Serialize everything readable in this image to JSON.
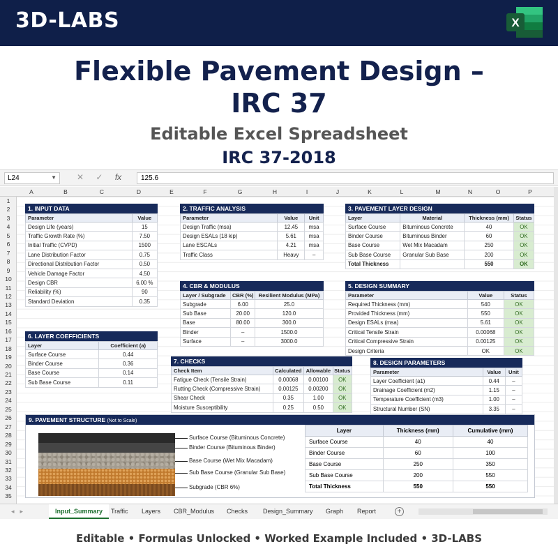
{
  "brand": "3D-LABS",
  "title_line1": "Flexible Pavement Design –",
  "title_line2": "IRC 37",
  "subtitle": "Editable Excel Spreadsheet",
  "subtitle2": "IRC 37-2018",
  "formula_bar": {
    "name_box": "L24",
    "formula_value": "125.6",
    "fx_label": "fx"
  },
  "columns": [
    "A",
    "B",
    "C",
    "D",
    "E",
    "F",
    "G",
    "H",
    "I",
    "J",
    "K",
    "L",
    "M",
    "N",
    "O",
    "P"
  ],
  "rows": [
    "1",
    "2",
    "3",
    "4",
    "5",
    "6",
    "7",
    "8",
    "9",
    "10",
    "11",
    "12",
    "13",
    "14",
    "15",
    "16",
    "17",
    "18",
    "19",
    "20",
    "21",
    "22",
    "23",
    "24",
    "25",
    "26",
    "27",
    "28",
    "29",
    "30",
    "31",
    "32",
    "33",
    "34",
    "35"
  ],
  "input_data": {
    "title": "1. INPUT DATA",
    "headers": [
      "Parameter",
      "Value"
    ],
    "rows": [
      [
        "Design Life (years)",
        "15"
      ],
      [
        "Traffic Growth Rate (%)",
        "7.50"
      ],
      [
        "Initial Traffic (CVPD)",
        "1500"
      ],
      [
        "Lane Distribution Factor",
        "0.75"
      ],
      [
        "Directional Distribution Factor",
        "0.50"
      ],
      [
        "Vehicle Damage Factor",
        "4.50"
      ],
      [
        "Design CBR",
        "6.00 %"
      ],
      [
        "Reliability (%)",
        "90"
      ],
      [
        "Standard Deviation",
        "0.35"
      ]
    ]
  },
  "traffic_analysis": {
    "title": "2. TRAFFIC ANALYSIS",
    "headers": [
      "Parameter",
      "Value",
      "Unit"
    ],
    "rows": [
      [
        "Design Traffic (msa)",
        "12.45",
        "msa"
      ],
      [
        "Design ESALs (18 kip)",
        "5.61",
        "msa"
      ],
      [
        "Lane ESCALs",
        "4.21",
        "msa"
      ],
      [
        "Traffic Class",
        "Heavy",
        "–"
      ]
    ]
  },
  "pavement_layer_design": {
    "title": "3. PAVEMENT LAYER DESIGN",
    "headers": [
      "Layer",
      "Material",
      "Thickness (mm)",
      "Status"
    ],
    "rows": [
      [
        "Surface Course",
        "Bituminous Concrete",
        "40",
        "OK"
      ],
      [
        "Binder Course",
        "Bituminous Binder",
        "60",
        "OK"
      ],
      [
        "Base Course",
        "Wet Mix Macadam",
        "250",
        "OK"
      ],
      [
        "Sub Base Course",
        "Granular Sub Base",
        "200",
        "OK"
      ]
    ],
    "total": [
      "Total Thickness",
      "",
      "550",
      "OK"
    ]
  },
  "cbr_modulus": {
    "title": "4. CBR & MODULUS",
    "headers": [
      "Layer / Subgrade",
      "CBR (%)",
      "Resilient Modulus (MPa)"
    ],
    "rows": [
      [
        "Subgrade",
        "6.00",
        "25.0"
      ],
      [
        "Sub Base",
        "20.00",
        "120.0"
      ],
      [
        "Base",
        "80.00",
        "300.0"
      ],
      [
        "Binder",
        "–",
        "1500.0"
      ],
      [
        "Surface",
        "–",
        "3000.0"
      ]
    ]
  },
  "design_summary": {
    "title": "5. DESIGN SUMMARY",
    "headers": [
      "Parameter",
      "Value",
      "Status"
    ],
    "rows": [
      [
        "Required Thickness (mm)",
        "540",
        "OK"
      ],
      [
        "Provided Thickness (mm)",
        "550",
        "OK"
      ],
      [
        "Design ESALs (msa)",
        "5.61",
        "OK"
      ],
      [
        "Critical Tensile Strain",
        "0.00068",
        "OK"
      ],
      [
        "Critical Compressive Strain",
        "0.00125",
        "OK"
      ],
      [
        "Design Criteria",
        "OK",
        "OK"
      ]
    ]
  },
  "layer_coefficients": {
    "title": "6. LAYER COEFFICIENTS",
    "headers": [
      "Layer",
      "Coefficient (a)"
    ],
    "rows": [
      [
        "Surface Course",
        "0.44"
      ],
      [
        "Binder Course",
        "0.36"
      ],
      [
        "Base Course",
        "0.14"
      ],
      [
        "Sub Base Course",
        "0.11"
      ]
    ]
  },
  "checks": {
    "title": "7. CHECKS",
    "headers": [
      "Check Item",
      "Calculated",
      "Allowable",
      "Status"
    ],
    "rows": [
      [
        "Fatigue Check (Tensile Strain)",
        "0.00068",
        "0.00100",
        "OK"
      ],
      [
        "Rutting Check (Compressive Strain)",
        "0.00125",
        "0.00200",
        "OK"
      ],
      [
        "Shear Check",
        "0.35",
        "1.00",
        "OK"
      ],
      [
        "Moisture Susceptibility",
        "0.25",
        "0.50",
        "OK"
      ]
    ]
  },
  "design_parameters": {
    "title": "8. DESIGN PARAMETERS",
    "headers": [
      "Parameter",
      "Value",
      "Unit"
    ],
    "rows": [
      [
        "Layer Coefficient (a1)",
        "0.44",
        "–"
      ],
      [
        "Drainage Coefficient (m2)",
        "1.15",
        "–"
      ],
      [
        "Temperature Coefficient (m3)",
        "1.00",
        "–"
      ],
      [
        "Structural Number (SN)",
        "3.35",
        "–"
      ]
    ]
  },
  "pavement_structure": {
    "title": "9. PAVEMENT STRUCTURE",
    "note": "(Not to Scale)",
    "labels": [
      "Surface Course (Bituminous Concrete)",
      "Binder Course (Bituminous Binder)",
      "Base Course (Wet Mix Macadam)",
      "Sub Base Course (Granular Sub Base)",
      "Subgrade (CBR 6%)"
    ],
    "table_headers": [
      "Layer",
      "Thickness (mm)",
      "Cumulative (mm)"
    ],
    "table_rows": [
      [
        "Surface Course",
        "40",
        "40"
      ],
      [
        "Binder Course",
        "60",
        "100"
      ],
      [
        "Base Course",
        "250",
        "350"
      ],
      [
        "Sub Base Course",
        "200",
        "550"
      ]
    ],
    "table_total": [
      "Total Thickness",
      "550",
      "550"
    ]
  },
  "sheet_tabs": [
    "Input_Summary",
    "Traffic",
    "Layers",
    "CBR_Modulus",
    "Checks",
    "Design_Summary",
    "Graph",
    "Report"
  ],
  "active_tab": "Input_Summary",
  "footer": "Editable  •  Formulas  Unlocked  •  Worked Example Included  •  3D-LABS",
  "colors": {
    "header_navy": "#0f1f49",
    "section_header": "#172a5a",
    "ok_fill": "#d8ecd0",
    "excel_green": "#1d6f2f"
  }
}
